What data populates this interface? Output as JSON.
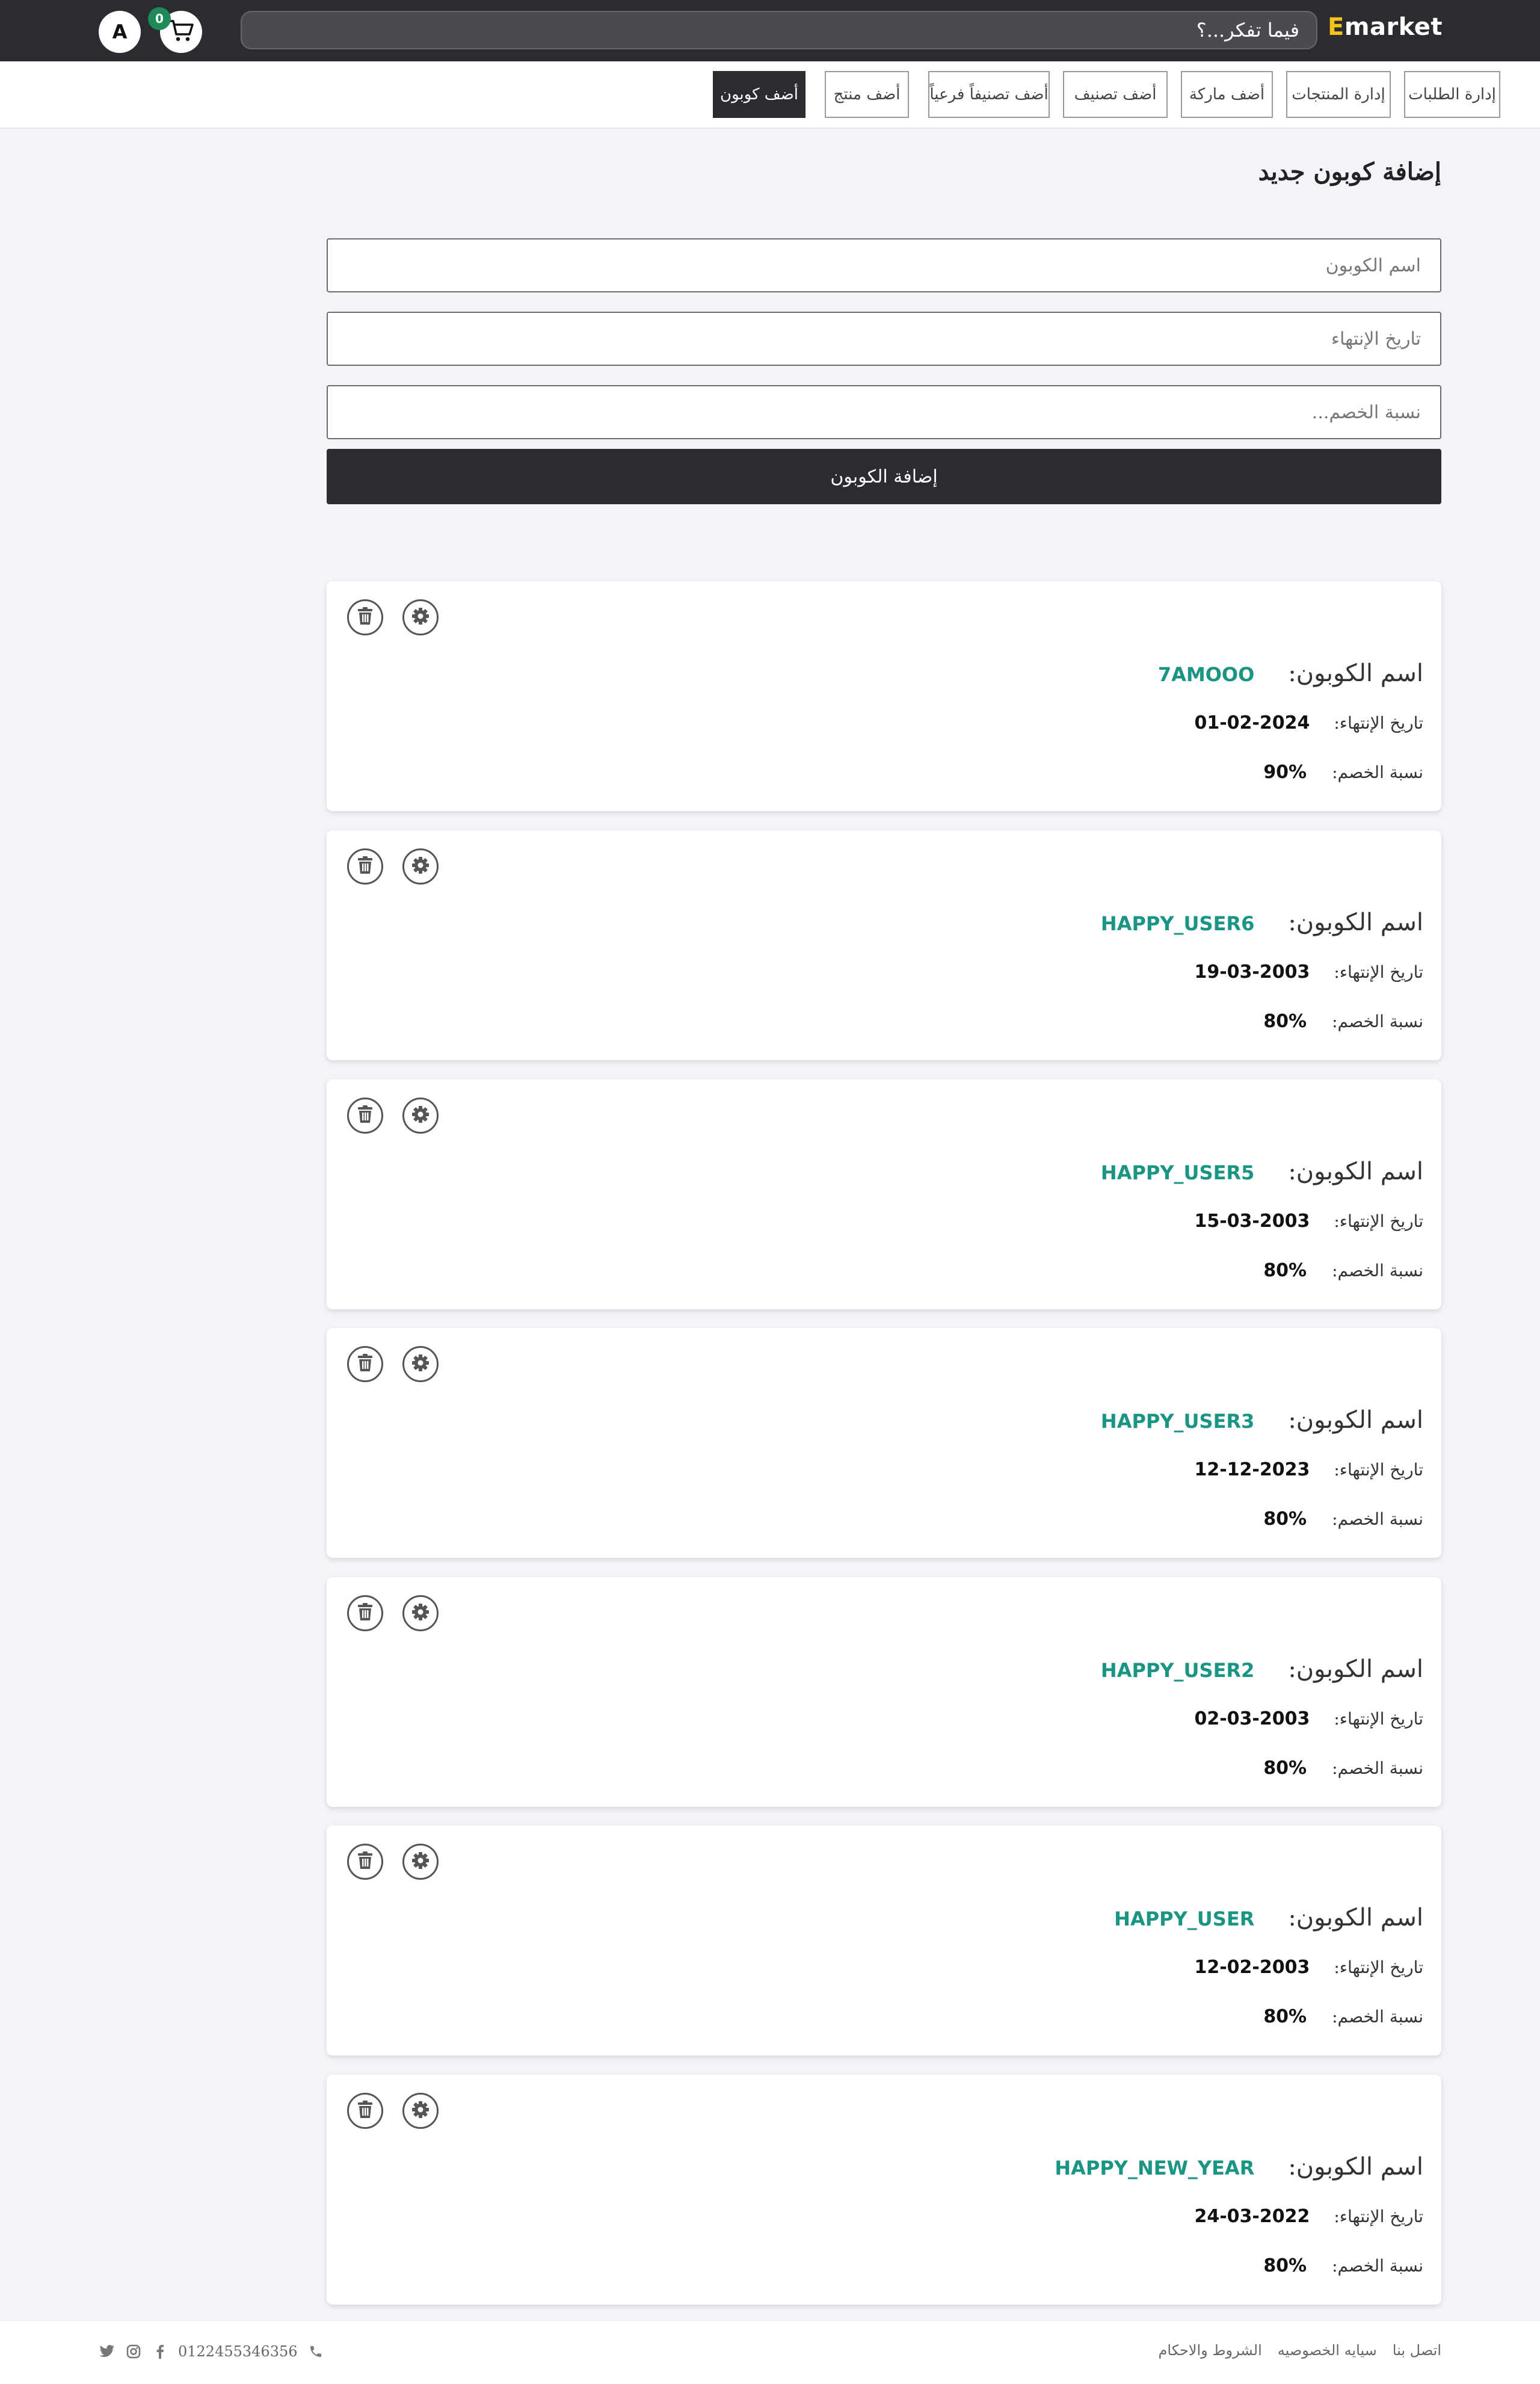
{
  "navbar": {
    "brand_first": "E",
    "brand_rest": "market",
    "search_placeholder": "فيما تفكر...؟",
    "cart_count": "0",
    "avatar_initial": "A"
  },
  "tabs": [
    {
      "label": "إدارة الطلبات",
      "active": false
    },
    {
      "label": "إدارة المنتجات",
      "active": false
    },
    {
      "label": "أضف ماركة",
      "active": false
    },
    {
      "label": "أضف تصنيف",
      "active": false
    },
    {
      "label": "أضف تصنيفاً فرعياً",
      "active": false
    },
    {
      "label": "أضف منتج",
      "active": false
    },
    {
      "label": "أضف كوبون",
      "active": true
    }
  ],
  "form": {
    "title": "إضافة كوبون جديد",
    "name_placeholder": "اسم الكوبون",
    "expiry_placeholder": "تاريخ الإنتهاء",
    "discount_placeholder": "نسبة الخصم...",
    "submit_label": "إضافة الكوبون"
  },
  "coupon_labels": {
    "name": "اسم الكوبون:",
    "expiry": "تاريخ الإنتهاء:",
    "discount": "نسبة الخصم:"
  },
  "coupons": [
    {
      "name": "7AMOOO",
      "expiry": "01-02-2024",
      "discount": "90%"
    },
    {
      "name": "HAPPY_USER6",
      "expiry": "19-03-2003",
      "discount": "80%"
    },
    {
      "name": "HAPPY_USER5",
      "expiry": "15-03-2003",
      "discount": "80%"
    },
    {
      "name": "HAPPY_USER3",
      "expiry": "12-12-2023",
      "discount": "80%"
    },
    {
      "name": "HAPPY_USER2",
      "expiry": "02-03-2003",
      "discount": "80%"
    },
    {
      "name": "HAPPY_USER",
      "expiry": "12-02-2003",
      "discount": "80%"
    },
    {
      "name": "HAPPY_NEW_YEAR",
      "expiry": "24-03-2022",
      "discount": "80%"
    }
  ],
  "footer": {
    "links": [
      "الشروط والاحكام",
      "سيايه الخصوصيه",
      "اتصل بنا"
    ],
    "phone": "0122455346356"
  },
  "colors": {
    "navbar_bg": "#2b2c31",
    "brand_accent": "#f6c21c",
    "coupon_name": "#1a9483",
    "cart_badge": "#1f8a58",
    "page_bg": "#f2f4f9"
  }
}
